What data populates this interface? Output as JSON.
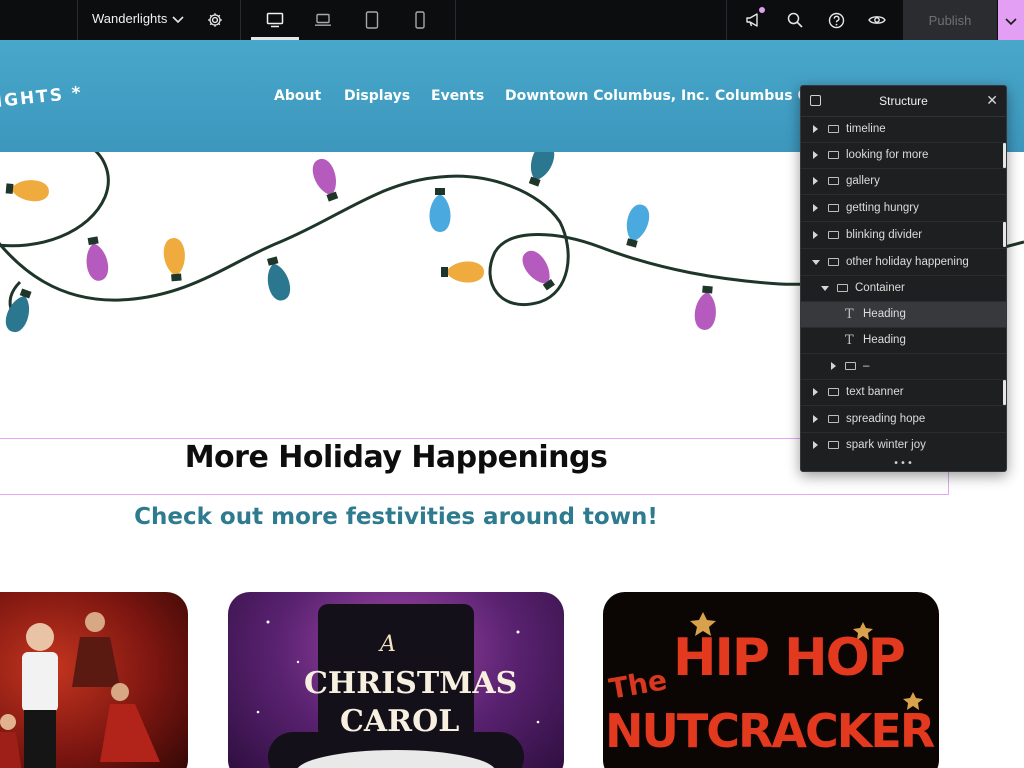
{
  "editor": {
    "site_name": "Wanderlights",
    "publish_label": "Publish"
  },
  "site": {
    "logo": "IGHTS *",
    "nav": [
      "About",
      "Displays",
      "Events",
      "Downtown Columbus, Inc.",
      "Columbus C"
    ]
  },
  "section": {
    "title": "More Holiday Happenings",
    "subtitle": "Check out more festivities around town!"
  },
  "cards": [
    {
      "name": "dance show poster"
    },
    {
      "name": "A Christmas Carol poster",
      "line1": "A",
      "line2": "CHRISTMAS",
      "line3": "CAROL"
    },
    {
      "name": "The Hip Hop Nutcracker poster",
      "line1": "The",
      "line2": "HIP HOP",
      "line3": "NUTCRACKER"
    }
  ],
  "structure_panel": {
    "title": "Structure",
    "items": [
      {
        "label": "timeline",
        "level": 0,
        "icon": "container-icon",
        "expanded": false
      },
      {
        "label": "looking for more",
        "level": 0,
        "icon": "container-icon",
        "expanded": false
      },
      {
        "label": "gallery",
        "level": 0,
        "icon": "container-icon",
        "expanded": false
      },
      {
        "label": "getting hungry",
        "level": 0,
        "icon": "container-icon",
        "expanded": false
      },
      {
        "label": "blinking divider",
        "level": 0,
        "icon": "container-icon",
        "expanded": false
      },
      {
        "label": "other holiday happening",
        "level": 0,
        "icon": "container-icon",
        "expanded": true
      },
      {
        "label": "Container",
        "level": 1,
        "icon": "container-icon",
        "expanded": true
      },
      {
        "label": "Heading",
        "level": 2,
        "icon": "text-icon",
        "selected": true
      },
      {
        "label": "Heading",
        "level": 2,
        "icon": "text-icon"
      },
      {
        "label": "–",
        "level": 2,
        "icon": "container-icon",
        "expanded": false
      },
      {
        "label": "text banner",
        "level": 0,
        "icon": "container-icon",
        "expanded": false
      },
      {
        "label": "spreading hope",
        "level": 0,
        "icon": "container-icon",
        "expanded": false
      },
      {
        "label": "spark winter joy",
        "level": 0,
        "icon": "container-icon",
        "expanded": false
      }
    ],
    "more": "•••"
  },
  "colors": {
    "header_blue": "#48a7cb",
    "subtitle_teal": "#2e7a8f",
    "accent_pink": "#e29ff3",
    "bulb_orange": "#f0ab3f",
    "bulb_purple": "#b55bbd",
    "bulb_blue": "#4aa9de",
    "bulb_teal": "#2c7790"
  }
}
